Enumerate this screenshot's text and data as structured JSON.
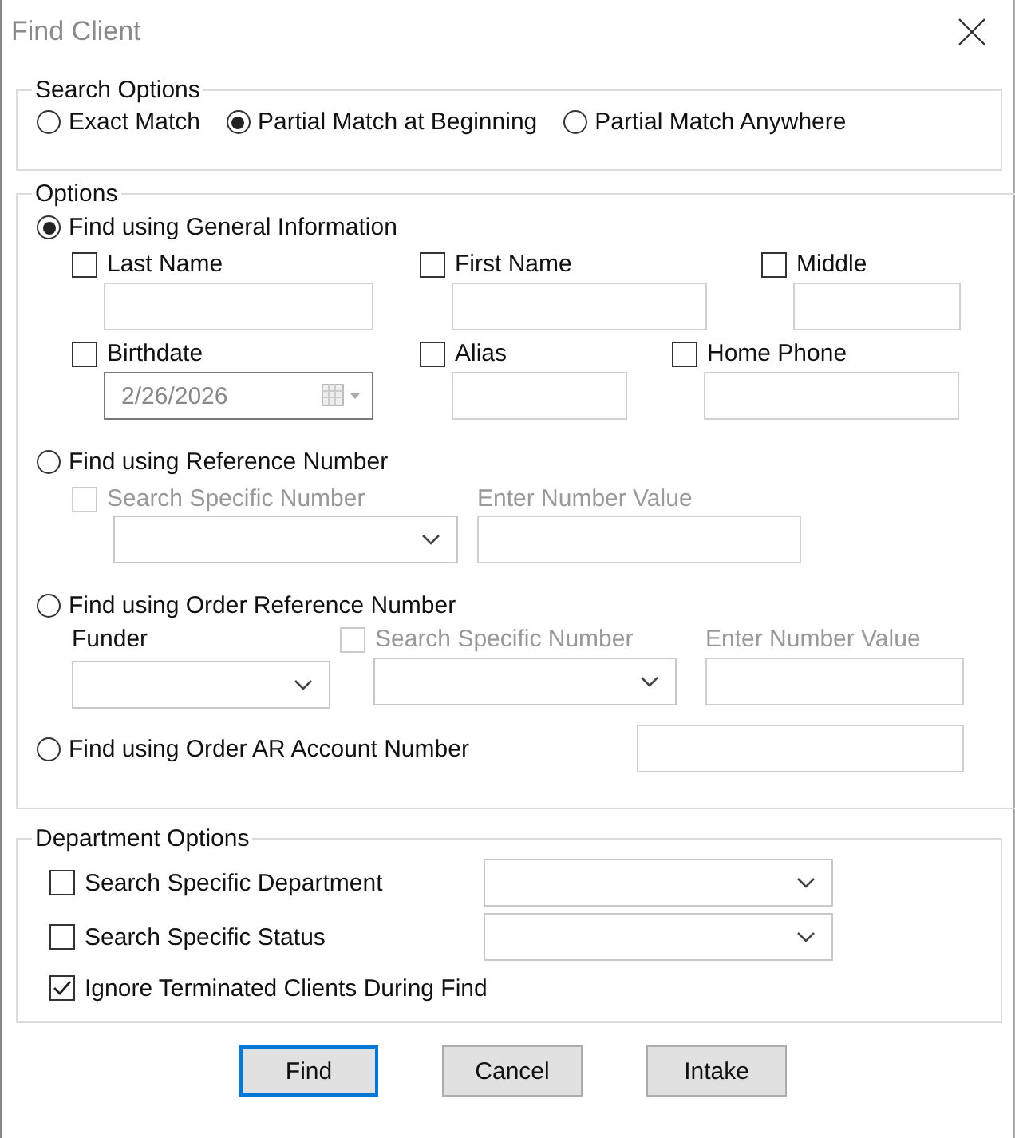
{
  "window": {
    "title": "Find Client"
  },
  "search_options": {
    "legend": "Search Options",
    "radios": [
      {
        "label": "Exact Match",
        "selected": false
      },
      {
        "label": "Partial Match at Beginning",
        "selected": true
      },
      {
        "label": "Partial Match Anywhere",
        "selected": false
      }
    ]
  },
  "options": {
    "legend": "Options",
    "general": {
      "label": "Find using General Information",
      "selected": true,
      "fields": [
        {
          "label": "Last Name",
          "checked": false,
          "kind": "text"
        },
        {
          "label": "First Name",
          "checked": false,
          "kind": "text"
        },
        {
          "label": "Middle",
          "checked": false,
          "kind": "text"
        },
        {
          "label": "Birthdate",
          "checked": false,
          "kind": "date",
          "value": "2/26/2026"
        },
        {
          "label": "Alias",
          "checked": false,
          "kind": "text"
        },
        {
          "label": "Home Phone",
          "checked": false,
          "kind": "text"
        }
      ]
    },
    "reference": {
      "label": "Find using Reference Number",
      "selected": false,
      "specific": {
        "label": "Search Specific Number",
        "checked": false,
        "disabled": true
      },
      "value_label": "Enter Number Value"
    },
    "order_reference": {
      "label": "Find using Order Reference Number",
      "selected": false,
      "funder_label": "Funder",
      "specific": {
        "label": "Search Specific Number",
        "checked": false,
        "disabled": true
      },
      "value_label": "Enter Number Value"
    },
    "ar_account": {
      "label": "Find using Order AR Account Number",
      "selected": false
    }
  },
  "department_options": {
    "legend": "Department Options",
    "rows": [
      {
        "label": "Search Specific Department",
        "checked": false,
        "kind": "dropdown"
      },
      {
        "label": "Search Specific Status",
        "checked": false,
        "kind": "dropdown"
      },
      {
        "label": "Ignore Terminated Clients During Find",
        "checked": true,
        "kind": "checkbox"
      }
    ]
  },
  "buttons": [
    {
      "label": "Find",
      "default": true
    },
    {
      "label": "Cancel",
      "default": false
    },
    {
      "label": "Intake",
      "default": false
    }
  ]
}
